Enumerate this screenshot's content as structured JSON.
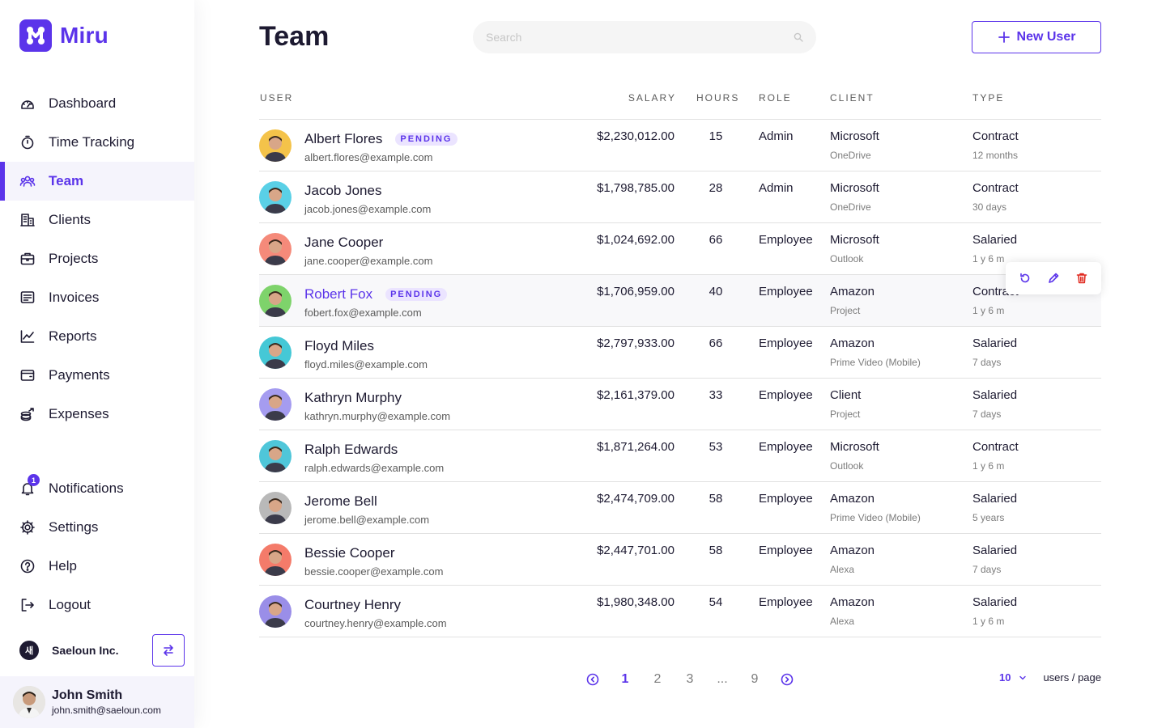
{
  "app": {
    "name": "Miru"
  },
  "sidebar": {
    "items": [
      {
        "label": "Dashboard",
        "icon": "dashboard-icon"
      },
      {
        "label": "Time Tracking",
        "icon": "stopwatch-icon"
      },
      {
        "label": "Team",
        "icon": "team-icon",
        "active": true
      },
      {
        "label": "Clients",
        "icon": "building-icon"
      },
      {
        "label": "Projects",
        "icon": "briefcase-icon"
      },
      {
        "label": "Invoices",
        "icon": "invoice-icon"
      },
      {
        "label": "Reports",
        "icon": "chart-icon"
      },
      {
        "label": "Payments",
        "icon": "wallet-icon"
      },
      {
        "label": "Expenses",
        "icon": "coins-icon"
      }
    ],
    "bottom_items": [
      {
        "label": "Notifications",
        "icon": "bell-icon",
        "badge": "1"
      },
      {
        "label": "Settings",
        "icon": "gear-icon"
      },
      {
        "label": "Help",
        "icon": "help-icon"
      },
      {
        "label": "Logout",
        "icon": "logout-icon"
      }
    ],
    "org": {
      "logo_text": "새",
      "name": "Saeloun Inc."
    },
    "user": {
      "name": "John Smith",
      "email": "john.smith@saeloun.com"
    }
  },
  "header": {
    "title": "Team",
    "search_placeholder": "Search",
    "new_user_label": "New User"
  },
  "table": {
    "headers": {
      "user": "USER",
      "salary": "SALARY",
      "hours": "HOURS",
      "role": "ROLE",
      "client": "CLIENT",
      "type": "TYPE"
    },
    "pending_label": "PENDING",
    "rows": [
      {
        "name": "Albert Flores",
        "email": "albert.flores@example.com",
        "salary": "$2,230,012.00",
        "hours": "15",
        "role": "Admin",
        "client": "Microsoft",
        "client_sub": "OneDrive",
        "type": "Contract",
        "type_sub": "12 months",
        "pending": true,
        "avatar_color": "#f4c34a"
      },
      {
        "name": "Jacob Jones",
        "email": "jacob.jones@example.com",
        "salary": "$1,798,785.00",
        "hours": "28",
        "role": "Admin",
        "client": "Microsoft",
        "client_sub": "OneDrive",
        "type": "Contract",
        "type_sub": "30 days",
        "pending": false,
        "avatar_color": "#5ad0e6"
      },
      {
        "name": "Jane Cooper",
        "email": "jane.cooper@example.com",
        "salary": "$1,024,692.00",
        "hours": "66",
        "role": "Employee",
        "client": "Microsoft",
        "client_sub": "Outlook",
        "type": "Salaried",
        "type_sub": "1 y 6 m",
        "pending": false,
        "avatar_color": "#f58a7a"
      },
      {
        "name": "Robert Fox",
        "email": "fobert.fox@example.com",
        "salary": "$1,706,959.00",
        "hours": "40",
        "role": "Employee",
        "client": "Amazon",
        "client_sub": "Project",
        "type": "Contract",
        "type_sub": "1 y 6 m",
        "pending": true,
        "hover": true,
        "avatar_color": "#7ed36b"
      },
      {
        "name": "Floyd Miles",
        "email": "floyd.miles@example.com",
        "salary": "$2,797,933.00",
        "hours": "66",
        "role": "Employee",
        "client": "Amazon",
        "client_sub": "Prime Video (Mobile)",
        "type": "Salaried",
        "type_sub": "7 days",
        "pending": false,
        "avatar_color": "#45c8d6"
      },
      {
        "name": "Kathryn Murphy",
        "email": "kathryn.murphy@example.com",
        "salary": "$2,161,379.00",
        "hours": "33",
        "role": "Employee",
        "client": "Client",
        "client_sub": "Project",
        "type": "Salaried",
        "type_sub": "7 days",
        "pending": false,
        "avatar_color": "#a59cf0"
      },
      {
        "name": "Ralph Edwards",
        "email": "ralph.edwards@example.com",
        "salary": "$1,871,264.00",
        "hours": "53",
        "role": "Employee",
        "client": "Microsoft",
        "client_sub": "Outlook",
        "type": "Contract",
        "type_sub": "1 y 6 m",
        "pending": false,
        "avatar_color": "#4fc6d9"
      },
      {
        "name": "Jerome Bell",
        "email": "jerome.bell@example.com",
        "salary": "$2,474,709.00",
        "hours": "58",
        "role": "Employee",
        "client": "Amazon",
        "client_sub": "Prime Video (Mobile)",
        "type": "Salaried",
        "type_sub": "5 years",
        "pending": false,
        "avatar_color": "#b9b9b9"
      },
      {
        "name": "Bessie Cooper",
        "email": "bessie.cooper@example.com",
        "salary": "$2,447,701.00",
        "hours": "58",
        "role": "Employee",
        "client": "Amazon",
        "client_sub": "Alexa",
        "type": "Salaried",
        "type_sub": "7 days",
        "pending": false,
        "avatar_color": "#f47b6a"
      },
      {
        "name": "Courtney Henry",
        "email": "courtney.henry@example.com",
        "salary": "$1,980,348.00",
        "hours": "54",
        "role": "Employee",
        "client": "Amazon",
        "client_sub": "Alexa",
        "type": "Salaried",
        "type_sub": "1 y 6 m",
        "pending": false,
        "avatar_color": "#9a8ee8"
      }
    ]
  },
  "pagination": {
    "pages": [
      "1",
      "2",
      "3",
      "...",
      "9"
    ],
    "current": "1",
    "per_page": "10",
    "per_page_label": "users / page"
  },
  "colors": {
    "accent": "#5b34ea",
    "delete": "#e0291f"
  }
}
